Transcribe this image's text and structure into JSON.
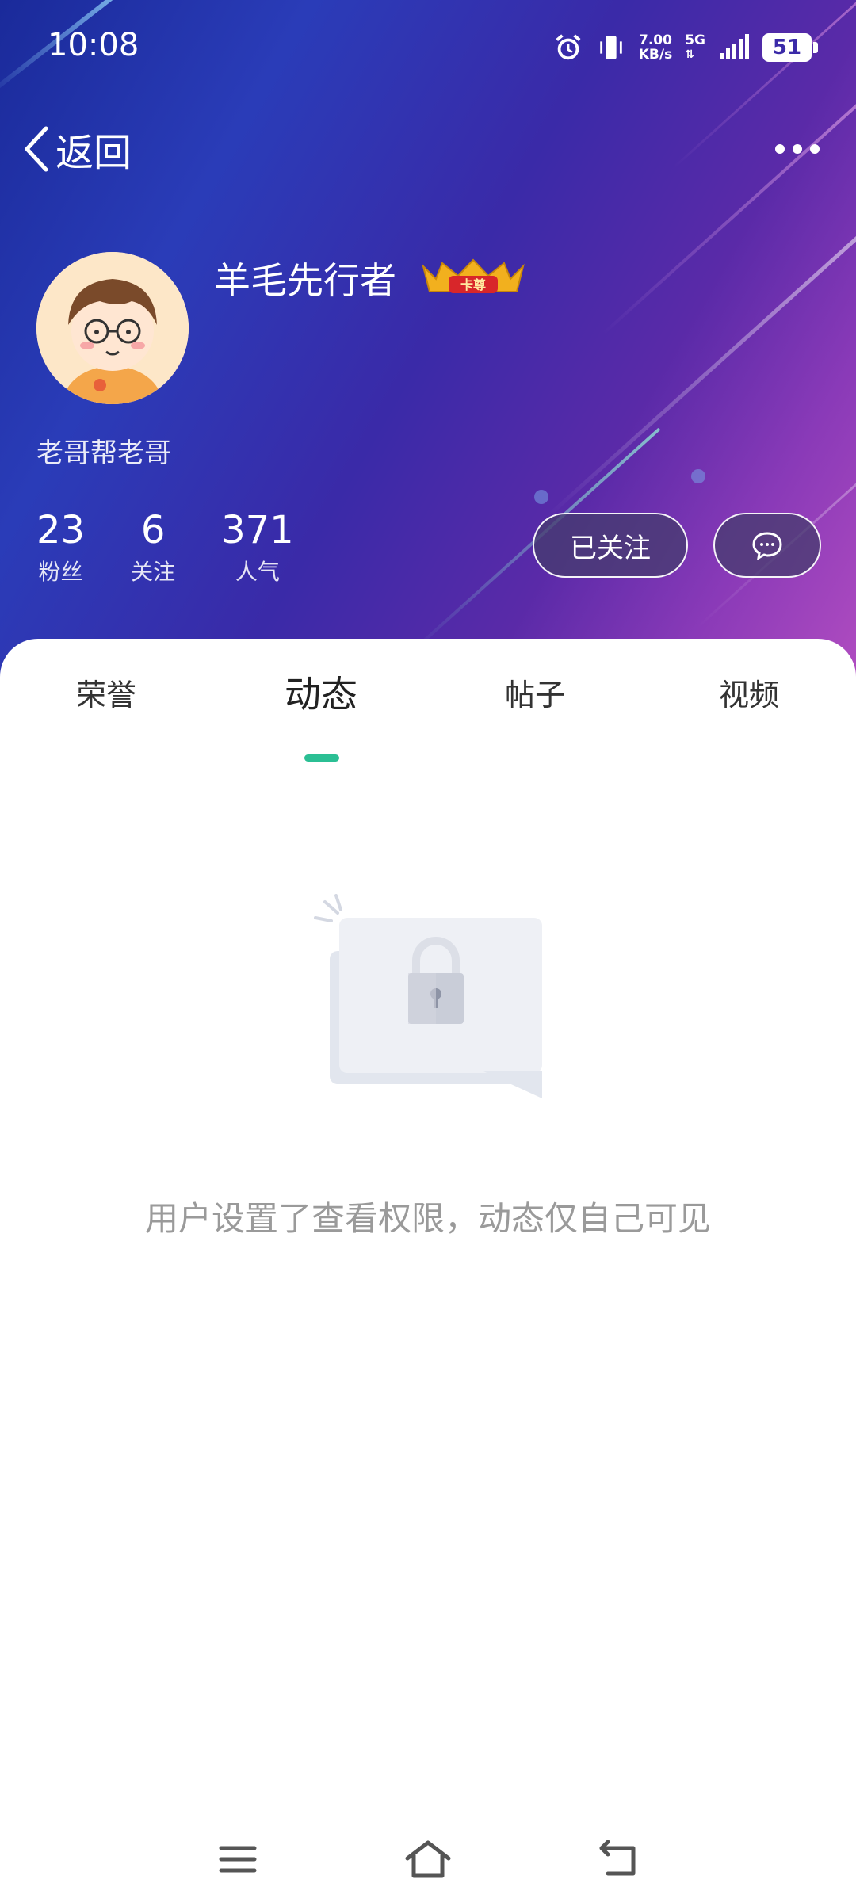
{
  "status_bar": {
    "time": "10:08",
    "net_speed_value": "7.00",
    "net_speed_unit": "KB/s",
    "net_type": "5G",
    "battery": "51",
    "icons": [
      "alarm-icon",
      "vibrate-icon",
      "signal-icon",
      "battery-icon"
    ]
  },
  "header": {
    "back_label": "返回",
    "more_icon": "more-dots-icon"
  },
  "profile": {
    "username": "羊毛先行者",
    "badge_text": "卡尊",
    "signature": "老哥帮老哥",
    "stats": [
      {
        "value": "23",
        "label": "粉丝"
      },
      {
        "value": "6",
        "label": "关注"
      },
      {
        "value": "371",
        "label": "人气"
      }
    ],
    "follow_label": "已关注",
    "message_icon": "chat-bubble-icon"
  },
  "tabs": [
    {
      "label": "荣誉",
      "active": false
    },
    {
      "label": "动态",
      "active": true
    },
    {
      "label": "帖子",
      "active": false
    },
    {
      "label": "视频",
      "active": false
    }
  ],
  "empty_state": {
    "message": "用户设置了查看权限，动态仅自己可见",
    "icon": "lock-icon"
  },
  "nav_bar": {
    "icons": [
      "menu-icon",
      "home-icon",
      "back-icon"
    ]
  },
  "colors": {
    "accent": "#2bbf94",
    "banner_start": "#1a2a9a",
    "banner_end": "#b04cc0"
  }
}
